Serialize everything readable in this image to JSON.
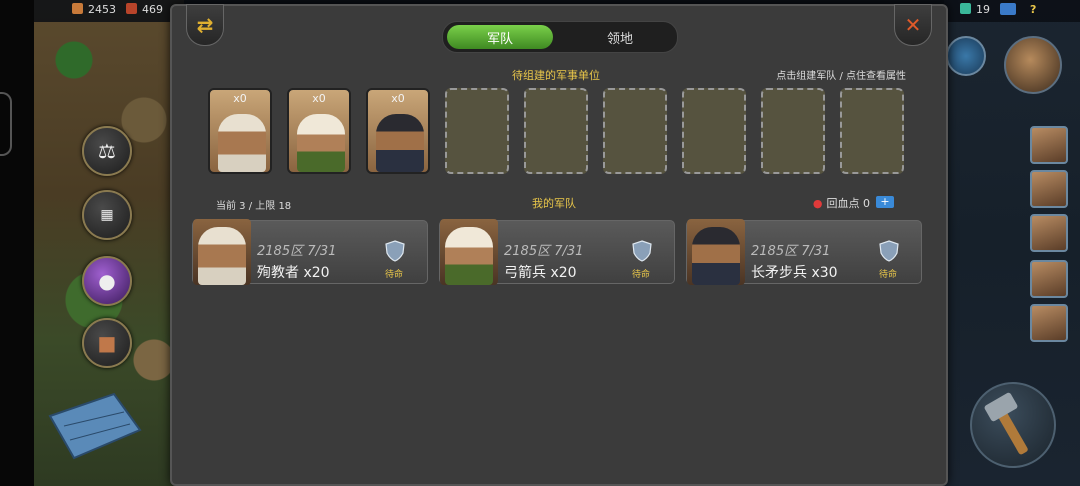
{
  "topbar": {
    "resource_1": "2453",
    "resource_2": "469",
    "resource_right": "19",
    "help": "?"
  },
  "tabs": [
    {
      "label": "军队",
      "active": true
    },
    {
      "label": "领地",
      "active": false
    }
  ],
  "build_section": {
    "title": "待组建的军事单位",
    "hint": "点击组建军队 / 点住查看属性",
    "units": [
      {
        "count": "x0",
        "unit": "martyr"
      },
      {
        "count": "x0",
        "unit": "archer"
      },
      {
        "count": "x0",
        "unit": "spearman"
      }
    ],
    "empty_slots": 6
  },
  "army_section": {
    "counter": "当前 3 / 上限 18",
    "title": "我的军队",
    "regen_label": "回血点 0",
    "regen_plus": "+",
    "cards": [
      {
        "zone": "2185区 7/31",
        "name": "殉教者 x20",
        "status": "待命"
      },
      {
        "zone": "2185区 7/31",
        "name": "弓箭兵 x20",
        "status": "待命"
      },
      {
        "zone": "2185区 7/31",
        "name": "长矛步兵 x30",
        "status": "待命"
      }
    ]
  },
  "colors": {
    "accent_green": "#5cb035",
    "gold_text": "#e8c64a",
    "panel_bg": "#3b3b3b"
  },
  "icons": [
    "swap-icon",
    "close-icon",
    "shield-icon",
    "blood-drop-icon",
    "plus-icon"
  ]
}
